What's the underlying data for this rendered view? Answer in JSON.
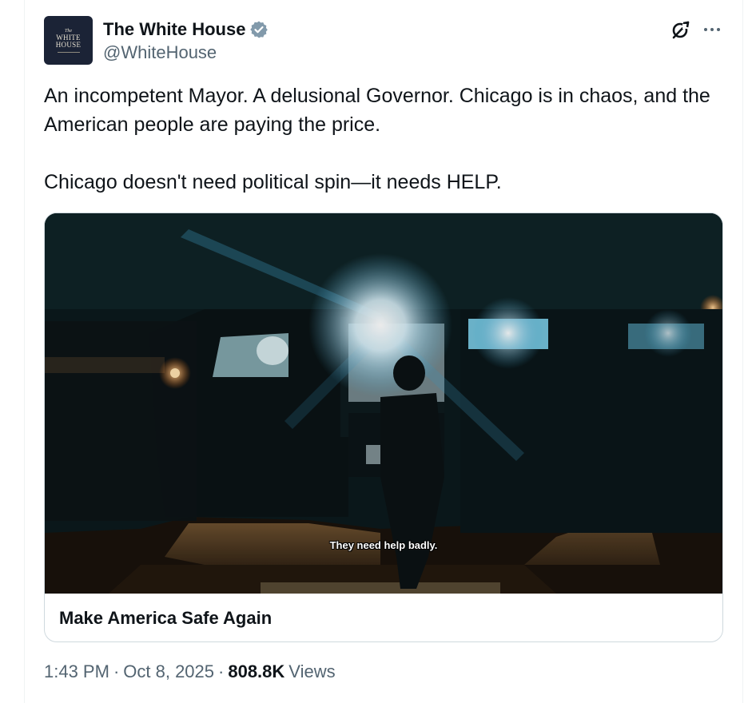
{
  "author": {
    "display_name": "The White House",
    "handle": "@WhiteHouse",
    "verified_color": "#829AAB",
    "avatar": {
      "line1": "The",
      "line2": "WHITE",
      "line3": "HOUSE",
      "background": "#1B2336"
    }
  },
  "actions": {
    "grok_icon": "grok-icon",
    "more_icon": "more-icon"
  },
  "tweet": {
    "paragraph1": "An incompetent Mayor. A delusional Governor. Chicago is in chaos, and the American people are paying the price.",
    "paragraph2": "Chicago doesn't need political spin—it needs HELP."
  },
  "media_card": {
    "video_caption": "They need help badly.",
    "title": "Make America Safe Again"
  },
  "meta": {
    "time": "1:43 PM",
    "separator": "·",
    "date": "Oct 8, 2025",
    "views_count": "808.8K",
    "views_label": "Views"
  }
}
